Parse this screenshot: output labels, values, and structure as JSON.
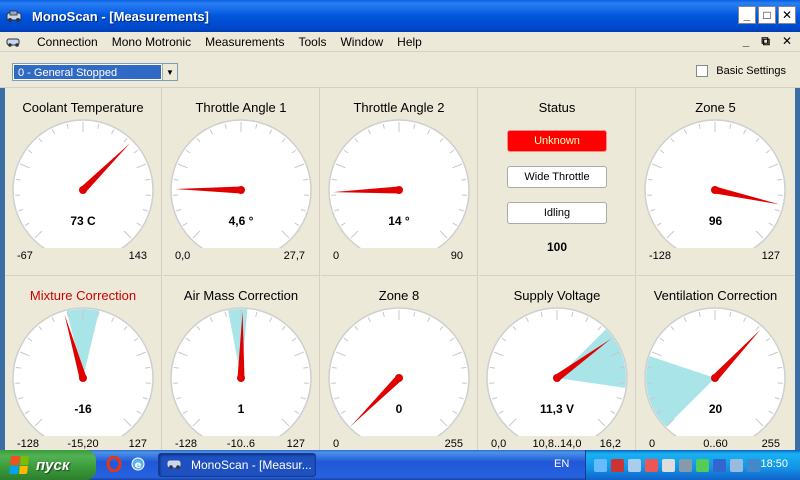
{
  "window": {
    "title": "MonoScan - [Measurements]"
  },
  "titlebar_buttons": [
    "_",
    "□",
    "✕"
  ],
  "menu": [
    "Connection",
    "Mono Motronic",
    "Measurements",
    "Tools",
    "Window",
    "Help"
  ],
  "mdi_controls": [
    "_",
    "⧉",
    "✕"
  ],
  "toolbar": {
    "combo_value": "0 - General Stopped",
    "checkbox_label": "Basic Settings"
  },
  "gauges": [
    {
      "title": "Coolant Temperature",
      "value": "73 C",
      "min": "-67",
      "max": "143",
      "mid": "",
      "title_color": "#000000",
      "needle_frac": 0.667
    },
    {
      "title": "Throttle Angle 1",
      "value": "4,6 °",
      "min": "0,0",
      "max": "27,7",
      "mid": "",
      "title_color": "#000000",
      "needle_frac": 0.17
    },
    {
      "title": "Throttle Angle 2",
      "value": "14 °",
      "min": "0",
      "max": "90",
      "mid": "",
      "title_color": "#000000",
      "needle_frac": 0.16
    },
    {
      "title": "Zone 5",
      "value": "96",
      "min": "-128",
      "max": "127",
      "mid": "",
      "title_color": "#000000",
      "needle_frac": 0.88
    },
    {
      "title": "Mixture Correction",
      "value": "-16",
      "min": "-128",
      "max": "127",
      "mid": "-15,20",
      "title_color": "#cc0000",
      "needle_frac": 0.44,
      "band": [
        0.45,
        0.55
      ]
    },
    {
      "title": "Air Mass Correction",
      "value": "1",
      "min": "-128",
      "max": "127",
      "mid": "-10..6",
      "title_color": "#000000",
      "needle_frac": 0.505,
      "band": [
        0.46,
        0.52
      ]
    },
    {
      "title": "Zone 8",
      "value": "0",
      "min": "0",
      "max": "255",
      "mid": "",
      "title_color": "#000000",
      "needle_frac": 0.0
    },
    {
      "title": "Supply Voltage",
      "value": "11,3 V",
      "min": "0,0",
      "max": "16,2",
      "mid": "10,8..14,0",
      "title_color": "#000000",
      "needle_frac": 0.7,
      "band": [
        0.667,
        0.864
      ]
    },
    {
      "title": "Ventilation Correction",
      "value": "20",
      "min": "0",
      "max": "255",
      "mid": "0..60",
      "title_color": "#000000",
      "needle_frac": 0.66,
      "band": [
        0.0,
        0.235
      ]
    }
  ],
  "status": {
    "title": "Status",
    "unknown": "Unknown",
    "wide_throttle": "Wide Throttle",
    "idling": "Idling",
    "value": "100"
  },
  "taskbar": {
    "start": "пуск",
    "task": "MonoScan - [Measur...",
    "lang": "EN",
    "clock": "18:50"
  },
  "colors": {
    "needle": "#e00000",
    "band": "#a8e4e8",
    "title_bar": "#0054e3",
    "taskbar": "#245edb",
    "start": "#3c9c3c"
  }
}
